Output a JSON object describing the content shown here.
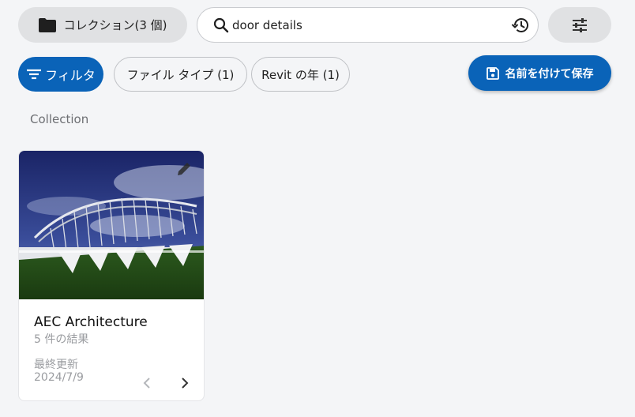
{
  "toolbar": {
    "collection_label": "コレクション(3 個)",
    "search_value": "door details"
  },
  "filters": {
    "filter_label": "フィルタ",
    "chips": [
      {
        "label": "ファイル タイプ (1)"
      },
      {
        "label": "Revit の年 (1)"
      }
    ],
    "save_label": "名前を付けて保存"
  },
  "section": {
    "label": "Collection"
  },
  "cards": [
    {
      "title": "AEC Architecture",
      "subtitle": "5 件の結果",
      "updated_label": "最終更新",
      "updated_date": "2024/7/9"
    }
  ],
  "colors": {
    "accent": "#0a63b8",
    "background": "#f4f5f7"
  },
  "icons": [
    "folder-icon",
    "search-icon",
    "history-icon",
    "tune-icon",
    "filter-icon",
    "save-icon",
    "edit-icon",
    "chevron-left-icon",
    "chevron-right-icon"
  ]
}
